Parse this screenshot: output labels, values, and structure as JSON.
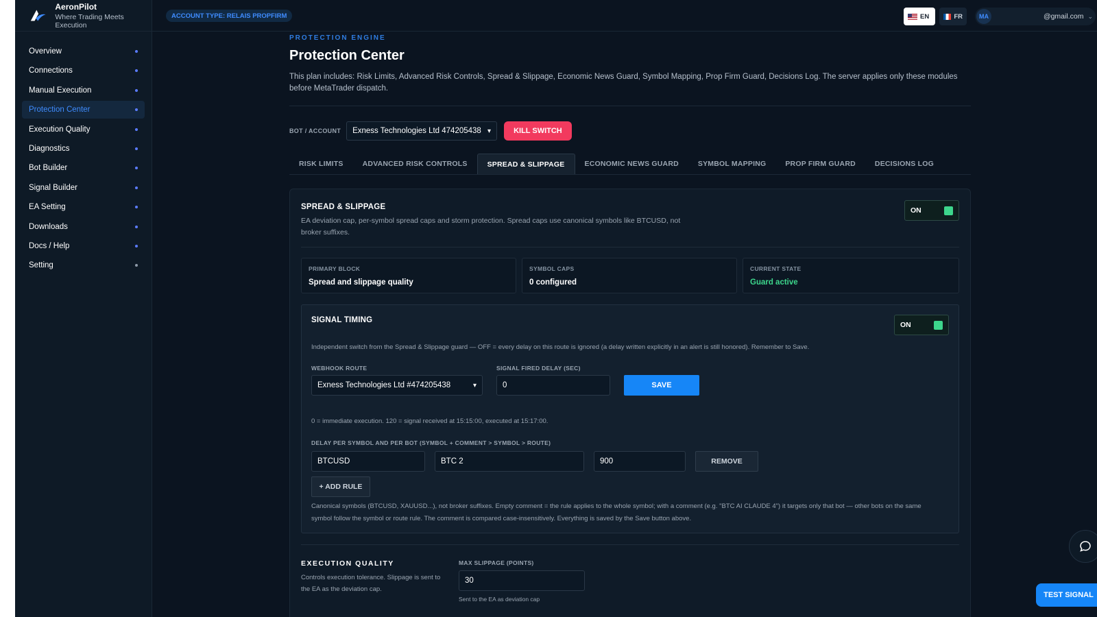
{
  "app": {
    "name": "AeronPilot",
    "tagline": "Where Trading Meets Execution"
  },
  "topbar": {
    "account_badge": "ACCOUNT TYPE: RELAIS PROPFIRM",
    "lang_en": "EN",
    "lang_fr": "FR",
    "avatar": "MA",
    "email": "@gmail.com"
  },
  "sidebar": {
    "items": [
      {
        "label": "Overview"
      },
      {
        "label": "Connections"
      },
      {
        "label": "Manual Execution"
      },
      {
        "label": "Protection Center"
      },
      {
        "label": "Execution Quality"
      },
      {
        "label": "Diagnostics"
      },
      {
        "label": "Bot Builder"
      },
      {
        "label": "Signal Builder"
      },
      {
        "label": "EA Setting"
      },
      {
        "label": "Downloads"
      },
      {
        "label": "Docs / Help"
      },
      {
        "label": "Setting"
      }
    ],
    "active_index": 3
  },
  "header": {
    "eyebrow": "PROTECTION ENGINE",
    "title": "Protection Center",
    "description": "This plan includes: Risk Limits, Advanced Risk Controls, Spread & Slippage, Economic News Guard, Symbol Mapping, Prop Firm Guard, Decisions Log. The server applies only these modules before MetaTrader dispatch."
  },
  "bot": {
    "label": "BOT / ACCOUNT",
    "selected": "Exness Technologies Ltd 474205438",
    "kill_switch": "KILL SWITCH"
  },
  "tabs": [
    {
      "label": "RISK LIMITS"
    },
    {
      "label": "ADVANCED RISK CONTROLS"
    },
    {
      "label": "SPREAD & SLIPPAGE"
    },
    {
      "label": "ECONOMIC NEWS GUARD"
    },
    {
      "label": "SYMBOL MAPPING"
    },
    {
      "label": "PROP FIRM GUARD"
    },
    {
      "label": "DECISIONS LOG"
    }
  ],
  "spread": {
    "title": "SPREAD & SLIPPAGE",
    "description": "EA deviation cap, per-symbol spread caps and storm protection. Spread caps use canonical symbols like BTCUSD, not broker suffixes.",
    "toggle": "ON"
  },
  "stats": [
    {
      "label": "PRIMARY BLOCK",
      "value": "Spread and slippage quality"
    },
    {
      "label": "SYMBOL CAPS",
      "value": "0 configured"
    },
    {
      "label": "CURRENT STATE",
      "value": "Guard active"
    }
  ],
  "timing": {
    "title": "SIGNAL TIMING",
    "toggle": "ON",
    "description": "Independent switch from the Spread & Slippage guard — OFF = every delay on this route is ignored (a delay written explicitly in an alert is still honored). Remember to Save.",
    "route_label": "WEBHOOK ROUTE",
    "route_value": "Exness Technologies Ltd #474205438",
    "delay_label": "SIGNAL FIRED DELAY (SEC)",
    "delay_value": "0",
    "save": "SAVE",
    "delay_hint": "0 = immediate execution. 120 = signal received at 15:15:00, executed at 15:17:00.",
    "rules_label": "DELAY PER SYMBOL AND PER BOT (SYMBOL + COMMENT > SYMBOL > ROUTE)",
    "rule": {
      "symbol": "BTCUSD",
      "comment": "BTC 2",
      "delay": "900"
    },
    "remove": "REMOVE",
    "add_rule": "+ ADD RULE",
    "footnote": "Canonical symbols (BTCUSD, XAUUSD...), not broker suffixes. Empty comment = the rule applies to the whole symbol; with a comment (e.g. \"BTC AI CLAUDE 4\") it targets only that bot — other bots on the same symbol follow the symbol or route rule. The comment is compared case-insensitively. Everything is saved by the Save button above."
  },
  "exec": {
    "title": "EXECUTION QUALITY",
    "description": "Controls execution tolerance. Slippage is sent to the EA as the deviation cap.",
    "slippage_label": "MAX SLIPPAGE (POINTS)",
    "slippage_value": "30",
    "slippage_hint": "Sent to the EA as deviation cap"
  },
  "floating": {
    "test_signal": "TEST SIGNAL"
  }
}
